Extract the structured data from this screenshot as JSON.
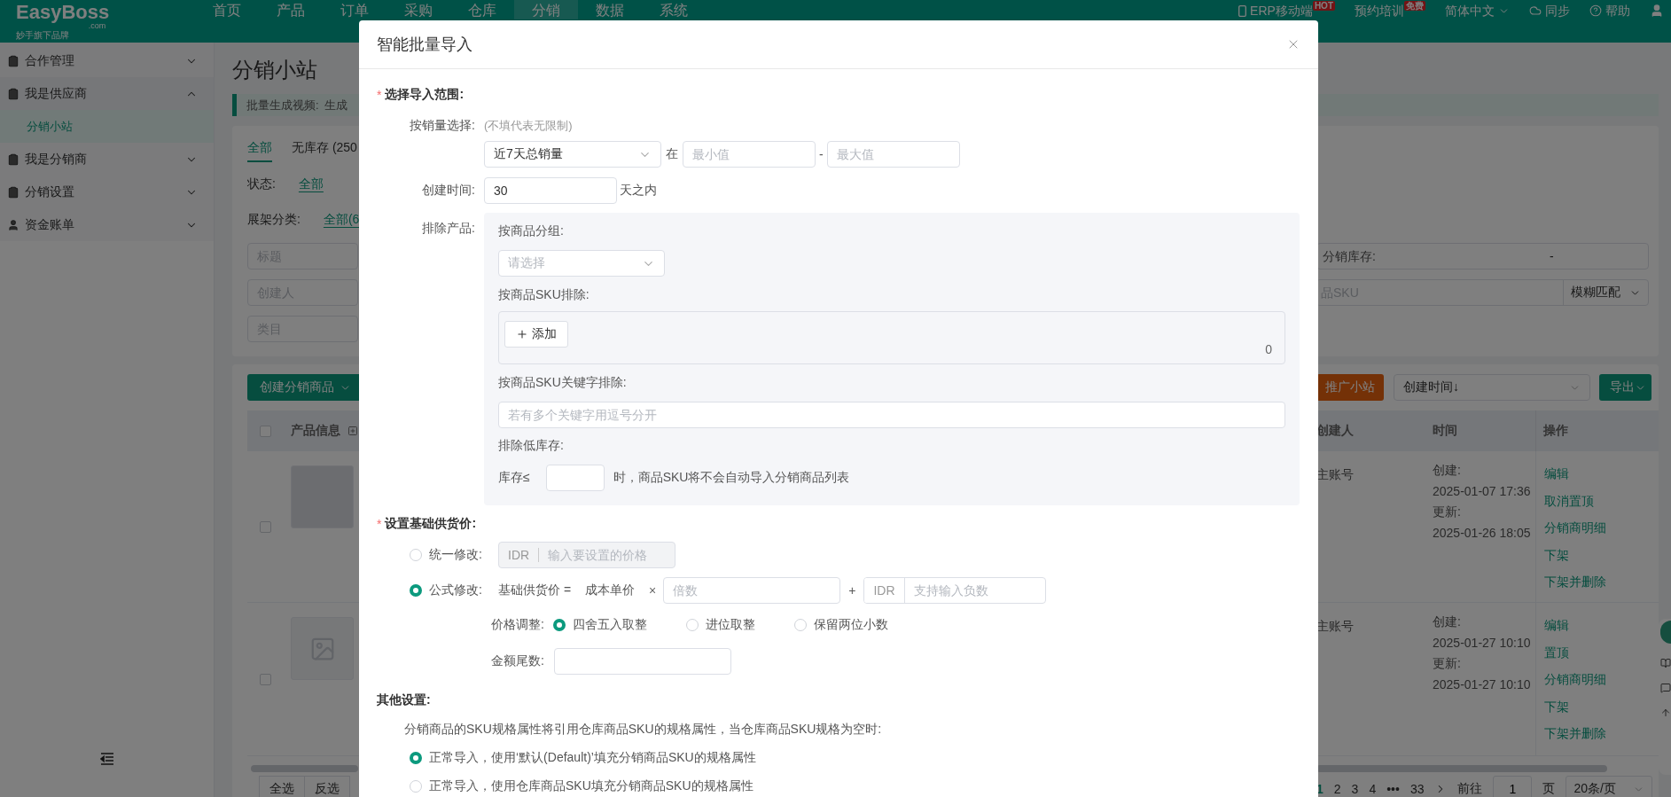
{
  "top_nav": {
    "logo": "EasyBoss",
    "logo_domain": ".com",
    "logo_tagline": "妙手旗下品牌",
    "menu": [
      {
        "label": "首页",
        "selected": false
      },
      {
        "label": "产品",
        "selected": false
      },
      {
        "label": "订单",
        "selected": false
      },
      {
        "label": "采购",
        "selected": false
      },
      {
        "label": "仓库",
        "selected": false
      },
      {
        "label": "分销",
        "selected": true
      },
      {
        "label": "数据",
        "selected": false
      },
      {
        "label": "系统",
        "selected": false
      }
    ],
    "tools": [
      {
        "kind": "mobile",
        "label": "ERP移动端",
        "badge": "HOT"
      },
      {
        "kind": "plain",
        "label": "预约培训",
        "badge": "免费"
      },
      {
        "kind": "language",
        "label": "简体中文"
      },
      {
        "kind": "sync",
        "label": "同步"
      },
      {
        "kind": "help",
        "label": "帮助"
      }
    ]
  },
  "sidebar": {
    "items": [
      {
        "kind": "clipboard",
        "label": "合作管理",
        "expanded": false
      },
      {
        "kind": "clipboard",
        "label": "我是供应商",
        "expanded": true,
        "children": [
          {
            "label": "分销小站",
            "selected": true
          }
        ]
      },
      {
        "kind": "clipboard",
        "label": "我是分销商",
        "expanded": false
      },
      {
        "kind": "clipboard",
        "label": "分销设置",
        "expanded": false
      },
      {
        "kind": "person",
        "label": "资金账单",
        "expanded": false
      }
    ]
  },
  "page": {
    "title": "分销小站",
    "notice": {
      "label": "批量生成视频:",
      "text": "生成"
    },
    "tabs": [
      {
        "label": "全部",
        "selected": true
      },
      {
        "label": "无库存 (250",
        "selected": false
      }
    ],
    "status_filter": {
      "label": "状态:",
      "options": [
        {
          "label": "全部",
          "selected": true
        }
      ]
    },
    "shelf_filter": {
      "label": "展架分类:",
      "options": [
        {
          "label": "全部(6",
          "selected": true
        }
      ]
    },
    "filters": [
      {
        "placeholder": "标题"
      },
      {
        "placeholder": "创建人"
      },
      {
        "placeholder": "类目"
      }
    ],
    "stock_filter": {
      "label": "分销库存:",
      "separator": "-"
    },
    "sku_filter": {
      "placeholder": "品SKU",
      "mode": "模糊匹配"
    },
    "create_button": "创建分销商品",
    "promote_button": "推广小站",
    "sort": "创建时间↓",
    "export_button": "导出",
    "table": {
      "header_checked": false,
      "column_product": "产品信息",
      "columns_right": [
        "创建人",
        "时间",
        "操作"
      ],
      "rows": [
        {
          "checked": false,
          "kind": "photo",
          "creator": "主账号",
          "times": [
            "创建:",
            "2025-01-07 17:36",
            "更新:",
            "2025-01-26 18:05"
          ],
          "actions": [
            "编辑",
            "取消置顶",
            "分销商明细",
            "下架",
            "下架并删除"
          ]
        },
        {
          "checked": false,
          "kind": "empty",
          "creator": "主账号",
          "times": [
            "创建:",
            "2025-01-27 10:10",
            "更新:",
            "2025-01-27 10:10"
          ],
          "actions": [
            "编辑",
            "置顶",
            "分销商明细",
            "下架",
            "下架并删除"
          ]
        }
      ]
    },
    "footer": {
      "select_all": "全选",
      "invert": "反选",
      "pages": [
        {
          "label": "1",
          "selected": true
        },
        {
          "label": "2",
          "selected": false
        },
        {
          "label": "3",
          "selected": false
        },
        {
          "label": "4",
          "selected": false
        },
        {
          "label": "•••",
          "selected": false
        },
        {
          "label": "33",
          "selected": false
        }
      ],
      "goto_label": "前往",
      "goto_value": "1",
      "page_unit": "页",
      "page_size": "20条/页"
    }
  },
  "dialog": {
    "title": "智能批量导入",
    "range_section": {
      "title": "选择导入范围:",
      "required_mark": "*",
      "sales": {
        "label": "按销量选择:",
        "hint": "(不填代表无限制)",
        "metric": "近7天总销量",
        "between": "在",
        "min_placeholder": "最小值",
        "dash": "-",
        "max_placeholder": "最大值"
      },
      "created": {
        "label": "创建时间:",
        "value": "30",
        "unit": "天之内"
      },
      "exclude": {
        "label": "排除产品:",
        "group_label": "按商品分组:",
        "group_placeholder": "请选择",
        "sku_label": "按商品SKU排除:",
        "add_button": "添加",
        "sku_count": "0",
        "keyword_label": "按商品SKU关键字排除:",
        "keyword_placeholder": "若有多个关键字用逗号分开",
        "low_stock_label": "排除低库存:",
        "stock_prefix": "库存≤",
        "stock_suffix": "时，商品SKU将不会自动导入分销商品列表"
      }
    },
    "price_section": {
      "title": "设置基础供货价:",
      "required_mark": "*",
      "modes": [
        {
          "kind": "uniform",
          "label": "统一修改:",
          "selected": false,
          "disabled": true,
          "currency": "IDR",
          "placeholder": "输入要设置的价格"
        },
        {
          "kind": "formula",
          "label": "公式修改:",
          "selected": true,
          "base": "基础供货价 =",
          "cost": "成本单价",
          "times": "×",
          "multiplier_placeholder": "倍数",
          "plus": "+",
          "currency": "IDR",
          "offset_placeholder": "支持输入负数"
        }
      ],
      "rounding": {
        "label": "价格调整:",
        "options": [
          {
            "label": "四舍五入取整",
            "selected": true
          },
          {
            "label": "进位取整",
            "selected": false
          },
          {
            "label": "保留两位小数",
            "selected": false
          }
        ]
      },
      "tail": {
        "label": "金额尾数:"
      }
    },
    "other_section": {
      "title": "其他设置:",
      "note": "分销商品的SKU规格属性将引用仓库商品SKU的规格属性，当仓库商品SKU规格为空时:",
      "options": [
        {
          "label": "正常导入，使用‘默认(Default)’填充分销商品SKU的规格属性",
          "selected": true
        },
        {
          "label": "正常导入，使用仓库商品SKU填充分销商品SKU的规格属性",
          "selected": false
        }
      ]
    }
  }
}
